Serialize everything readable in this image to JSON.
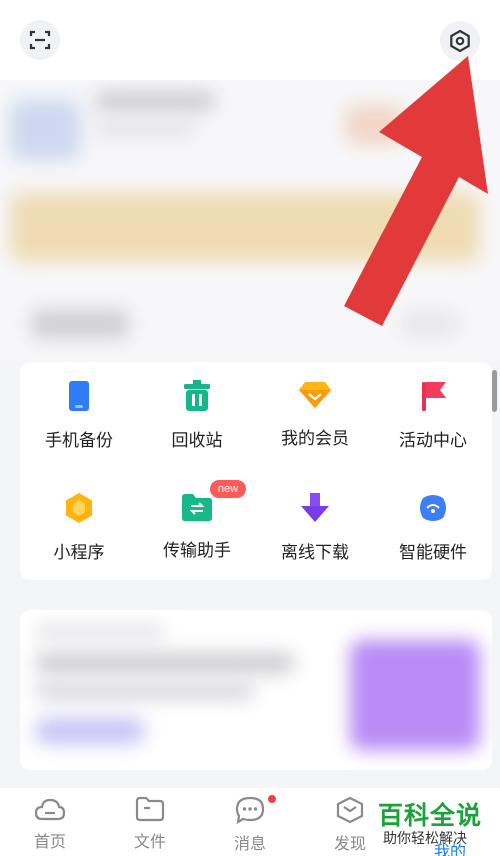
{
  "grid": {
    "items": [
      {
        "label": "手机备份",
        "icon": "phone-backup-icon"
      },
      {
        "label": "回收站",
        "icon": "trash-icon"
      },
      {
        "label": "我的会员",
        "icon": "diamond-icon"
      },
      {
        "label": "活动中心",
        "icon": "flag-icon"
      },
      {
        "label": "小程序",
        "icon": "hexagon-icon"
      },
      {
        "label": "传输助手",
        "icon": "transfer-folder-icon"
      },
      {
        "label": "离线下载",
        "icon": "download-arrow-icon"
      },
      {
        "label": "智能硬件",
        "icon": "smart-device-icon"
      }
    ],
    "new_badge": "new"
  },
  "bottom_nav": {
    "items": [
      {
        "label": "首页",
        "icon": "cloud-icon"
      },
      {
        "label": "文件",
        "icon": "folder-icon"
      },
      {
        "label": "消息",
        "icon": "chat-bubble-icon"
      },
      {
        "label": "发现",
        "icon": "discover-box-icon"
      }
    ],
    "me_label": "我的"
  },
  "watermark": {
    "title": "百科全说",
    "subtitle": "助你轻松解决"
  },
  "colors": {
    "arrow": "#e23a3a",
    "watermark_green": "#1aa33a",
    "nav_text": "#888888",
    "badge": "#ff5a5a"
  }
}
